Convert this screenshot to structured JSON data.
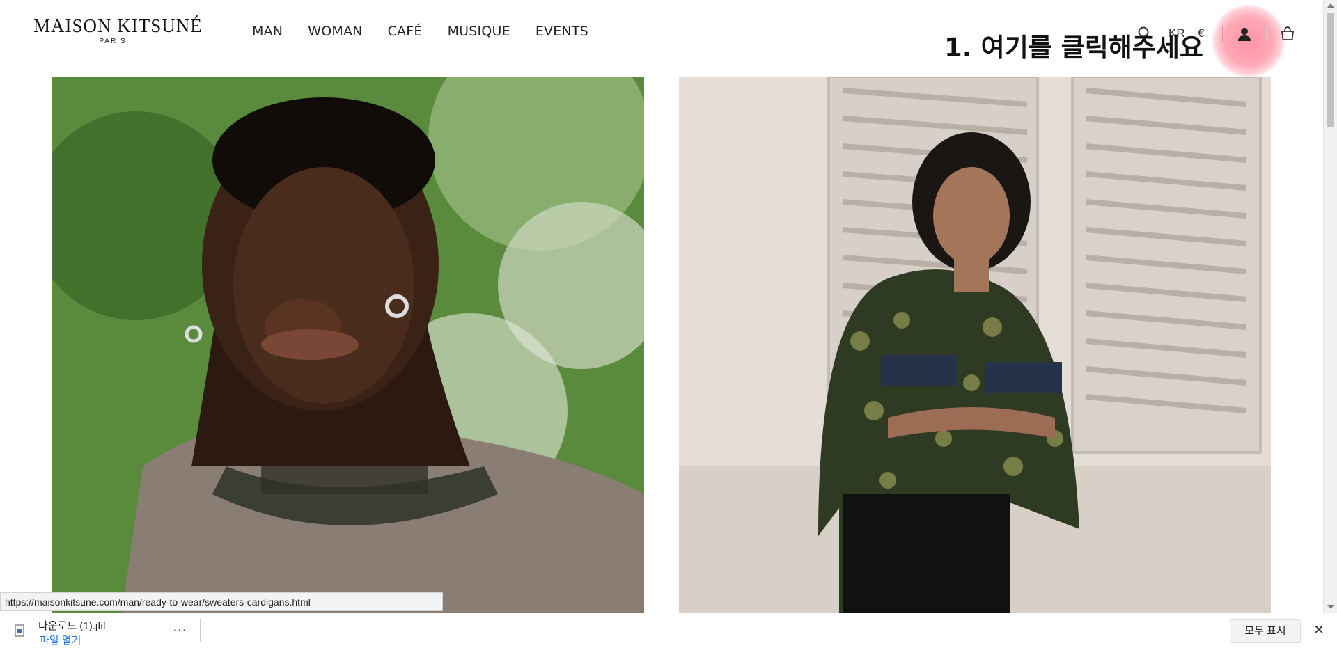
{
  "header": {
    "logo_main": "MAISON KITSUNÉ",
    "logo_sub": "PARIS",
    "nav": [
      "MAN",
      "WOMAN",
      "CAFÉ",
      "MUSIQUE",
      "EVENTS"
    ],
    "lang": "KR",
    "currency": "€"
  },
  "annotation": {
    "text": "1. 여기를 클릭해주세요",
    "highlight_color": "#ff3c5a"
  },
  "status_url": "https://maisonkitsune.com/man/ready-to-wear/sweaters-cardigans.html",
  "download": {
    "file_name": "다운로드 (1).jfif",
    "open_label": "파일 열기",
    "more": "⋯",
    "show_all": "모두 표시",
    "close": "✕"
  },
  "icons": {
    "search": "search-icon",
    "account": "account-icon",
    "bag": "shopping-bag-icon"
  }
}
